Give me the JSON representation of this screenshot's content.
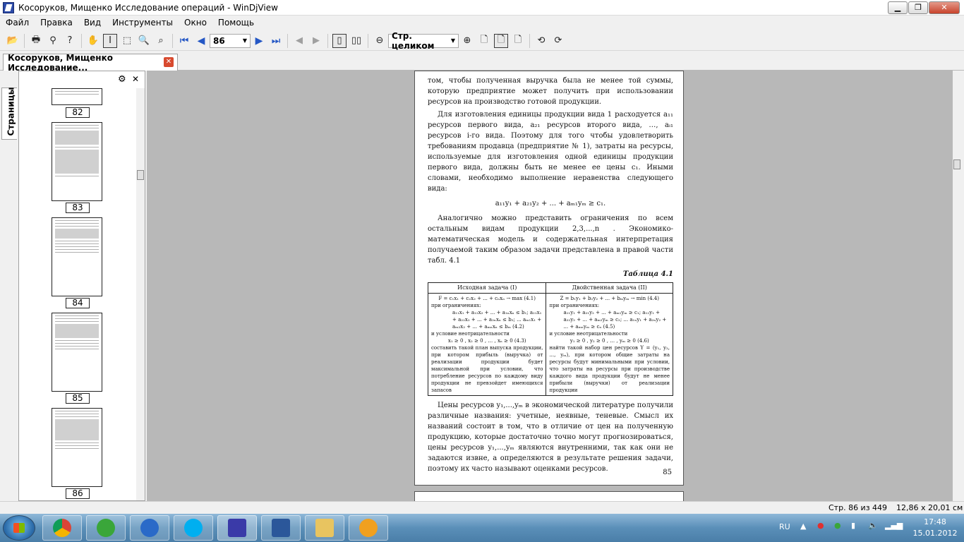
{
  "window": {
    "title": "Косоруков, Мищенко Исследование операций - WinDjView"
  },
  "menu": [
    "Файл",
    "Правка",
    "Вид",
    "Инструменты",
    "Окно",
    "Помощь"
  ],
  "toolbar": {
    "page_value": "86",
    "zoom_value": "Стр. целиком"
  },
  "tab": {
    "label": "Косоруков, Мищенко Исследование..."
  },
  "sidebar": {
    "tab_label": "Страницы",
    "thumbs": [
      "82",
      "83",
      "84",
      "85",
      "86"
    ]
  },
  "doc": {
    "p1": "том, чтобы полученная выручка была не менее той суммы, которую предприятие может получить при использовании ресурсов на производство готовой продукции.",
    "p2": "Для изготовления единицы продукции вида 1 расходуется a₁₁ ресурсов первого вида, a₂₁ ресурсов второго вида, …, aᵢ₁ ресурсов i-го вида. Поэтому для того чтобы удовлетворить требованиям продавца (предприятие № 1), затраты на ресурсы, используемые для изготовления одной единицы продукции первого вида, должны быть не менее ее цены c₁. Иными словами, необходимо выполнение неравенства следующего вида:",
    "formula": "a₁₁y₁ + a₂₁y₂ + ... + aₘ₁yₘ ≥ c₁.",
    "p3": "Аналогично можно представить ограничения по всем остальным видам продукции 2,3,...,n . Экономико-математическая модель и содержательная интерпретация получаемой таким образом задачи представлена в правой части табл. 4.1",
    "table_caption": "Таблица 4.1",
    "table": {
      "h_left": "Исходная задача (I)",
      "h_right": "Двойственная задача (II)",
      "l_obj": "F = c₁x₁ + c₂x₂ + ... + cₙxₙ → max   (4.1)",
      "r_obj": "Z = b₁y₁ + b₂y₂ + ... + bₘyₘ → min   (4.4)",
      "l_lim": "при ограничениях:",
      "r_lim": "при ограничениях:",
      "l_sys": "a₁₁x₁ + a₁₂x₂ + ... + a₁ₙxₙ ≤ b₁; a₂₁x₁ + a₂₂x₂ + ... + a₂ₙxₙ ≤ b₂; ... aₘ₁x₁ + aₘ₂x₂ + ... + aₘₙxₙ ≤ bₘ   (4.2)",
      "r_sys": "a₁₁y₁ + a₂₁y₂ + ... + aₘ₁yₘ ≥ c₁; a₁₂y₁ + a₂₂y₂ + ... + aₘ₂yₘ ≥ c₂; ... a₁ₙy₁ + a₂ₙy₂ + ... + aₘₙyₘ ≥ cₙ   (4.5)",
      "l_nn": "и условие неотрицательности",
      "r_nn": "и условие неотрицательности",
      "l_nnf": "x₁ ≥ 0 , x₂ ≥ 0 , … , xₙ ≥ 0   (4.3)",
      "r_nnf": "y₁ ≥ 0 , y₂ ≥ 0 , … , yₘ ≥ 0   (4.6)",
      "l_text": "составить такой план выпуска продукции, при котором прибыль (выручка) от реализации продукции будет максимальной при условии, что потребление ресурсов по каждому виду продукции не превзойдет имеющихся запасов",
      "r_text": "найти такой набор цен ресурсов Y = (y₁, y₂, ..., yₘ), при котором общие затраты на ресурсы будут минимальными при условии, что затраты на ресурсы при производстве каждого вида продукции будут не менее прибыли (выручки) от реализации продукции"
    },
    "p4": "Цены ресурсов y₁,...,yₘ в экономической литературе получили различные названия: учетные, неявные, теневые. Смысл их названий состоит в том, что в отличие от цен на полученную продукцию, которые достаточно точно могут прогнозироваться, цены ресурсов y₁,...,yₘ являются внутренними, так как они не задаются извне, а определяются в результате решения задачи, поэтому их часто называют оценками ресурсов.",
    "page_number": "85"
  },
  "status": {
    "page": "Стр. 86 из 449",
    "size": "12,86 x 20,01 см"
  },
  "tray": {
    "lang": "RU",
    "time": "17:48",
    "date": "15.01.2012"
  }
}
